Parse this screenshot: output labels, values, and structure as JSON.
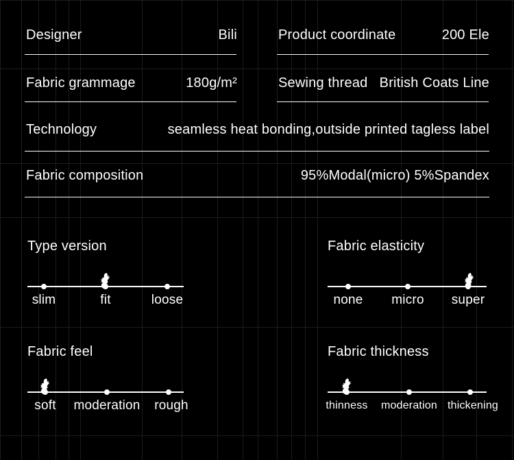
{
  "theme": {
    "background": "#000000",
    "text": "#ffffff",
    "rule": "#ffffff",
    "grid": "#1c1c1c"
  },
  "spec_rows": [
    {
      "name": "designer",
      "label": "Designer",
      "value": "Bili"
    },
    {
      "name": "product-coordinate",
      "label": "Product coordinate",
      "value": "200 Ele"
    },
    {
      "name": "fabric-grammage",
      "label": "Fabric grammage",
      "value": "180g/m²"
    },
    {
      "name": "sewing-thread",
      "label": "Sewing thread",
      "value": "British Coats Line"
    },
    {
      "name": "technology",
      "label": "Technology",
      "value": "seamless heat bonding,outside printed tagless label"
    },
    {
      "name": "fabric-composition",
      "label": "Fabric composition",
      "value": "95%Modal(micro)   5%Spandex"
    }
  ],
  "sliders": [
    {
      "name": "type-version",
      "title": "Type version",
      "options": [
        "slim",
        "fit",
        "loose"
      ],
      "selected_index": 1,
      "marker_icon": "person-marker-icon"
    },
    {
      "name": "fabric-elasticity",
      "title": "Fabric elasticity",
      "options": [
        "none",
        "micro",
        "super"
      ],
      "selected_index": 2,
      "marker_icon": "person-marker-icon"
    },
    {
      "name": "fabric-feel",
      "title": "Fabric feel",
      "options": [
        "soft",
        "moderation",
        "rough"
      ],
      "selected_index": 0,
      "marker_icon": "person-marker-icon"
    },
    {
      "name": "fabric-thickness",
      "title": "Fabric thickness",
      "options": [
        "thinness",
        "moderation",
        "thickening"
      ],
      "selected_index": 0,
      "marker_icon": "person-marker-icon"
    }
  ]
}
